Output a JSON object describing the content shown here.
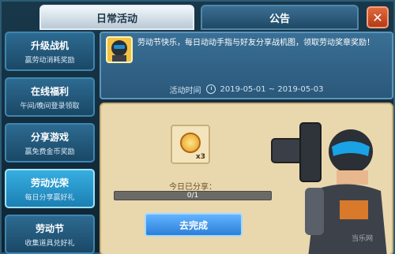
{
  "tabs": [
    {
      "label": "日常活动"
    },
    {
      "label": "公告"
    }
  ],
  "sidebar": {
    "items": [
      {
        "title": "升级战机",
        "subtitle": "赢劳动消耗奖励"
      },
      {
        "title": "在线福利",
        "subtitle": "午间/晚间登录领取"
      },
      {
        "title": "分享游戏",
        "subtitle": "赢免费金币奖励"
      },
      {
        "title": "劳动光荣",
        "subtitle": "每日分享赢好礼"
      },
      {
        "title": "劳动节",
        "subtitle": "收集道具兑好礼"
      }
    ]
  },
  "info": {
    "text": "劳动节快乐，每日动动手指与好友分享战机图，领取劳动奖章奖励！",
    "time_label": "活动时间",
    "time_range": "2019-05-01 ~ 2019-05-03"
  },
  "reward": {
    "icon": "medal-icon",
    "count": "x3"
  },
  "share": {
    "label": "今日已分享：",
    "progress_text": "0/1",
    "progress_fraction": 0
  },
  "action_button": "去完成",
  "watermark": "当乐网"
}
